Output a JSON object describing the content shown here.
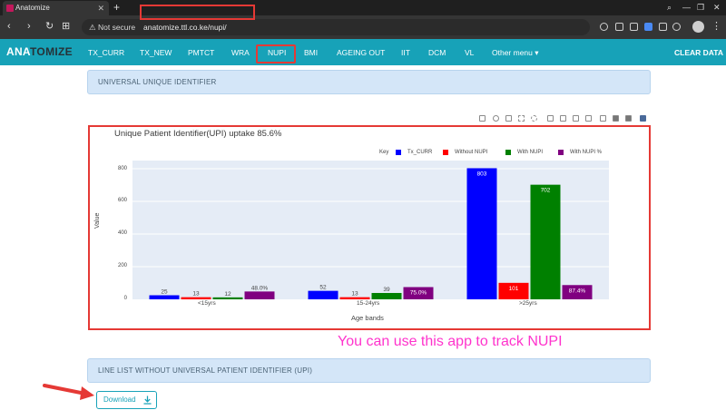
{
  "browser": {
    "tab_title": "Anatomize",
    "new_tab": "+",
    "security": "Not secure",
    "url": "anatomize.ttl.co.ke/nupi/",
    "back": "‹",
    "forward": "›",
    "reload": "↻",
    "apps": "⊞"
  },
  "navbar": {
    "brand_a": "ANA",
    "brand_b": "TOMIZE",
    "items": [
      "TX_CURR",
      "TX_NEW",
      "PMTCT",
      "WRA",
      "NUPI",
      "BMI",
      "AGEING OUT",
      "IIT",
      "DCM",
      "VL",
      "Other menu ▾"
    ],
    "clear": "CLEAR DATA"
  },
  "panels": {
    "top": "UNIVERSAL UNIQUE IDENTIFIER",
    "bottom": "LINE LIST WITHOUT UNIVERSAL PATIENT IDENTIFIER (UPI)"
  },
  "overlay_text": "You can use this app to track NUPI",
  "download_label": "Download",
  "colors": {
    "nav": "#17a2b8",
    "tx_curr": "#0000ff",
    "without_nupi": "#ff0000",
    "with_nupi": "#008000",
    "with_nupi_pct": "#800080",
    "highlight": "#e53935"
  },
  "chart_data": {
    "type": "bar",
    "title": "Unique Patient Identifier(UPI) uptake 85.6%",
    "legend_title": "Key",
    "xlabel": "Age bands",
    "ylabel": "Value",
    "categories": [
      "<15yrs",
      "15-24yrs",
      ">25yrs"
    ],
    "ylim": [
      0,
      850
    ],
    "yticks": [
      "0",
      "200",
      "400",
      "600",
      "800"
    ],
    "legend_position": "top-right",
    "grid": true,
    "series": [
      {
        "name": "Tx_CURR",
        "values": [
          25,
          52,
          803
        ],
        "labels": [
          "25",
          "52",
          "803"
        ]
      },
      {
        "name": "Without NUPI",
        "values": [
          13,
          13,
          101
        ],
        "labels": [
          "13",
          "13",
          "101"
        ]
      },
      {
        "name": "With NUPI",
        "values": [
          12,
          39,
          702
        ],
        "labels": [
          "12",
          "39",
          "702"
        ]
      },
      {
        "name": "With NUPI %",
        "values": [
          48.0,
          75.0,
          87.4
        ],
        "labels": [
          "48.0%",
          "75.0%",
          "87.4%"
        ]
      }
    ]
  }
}
